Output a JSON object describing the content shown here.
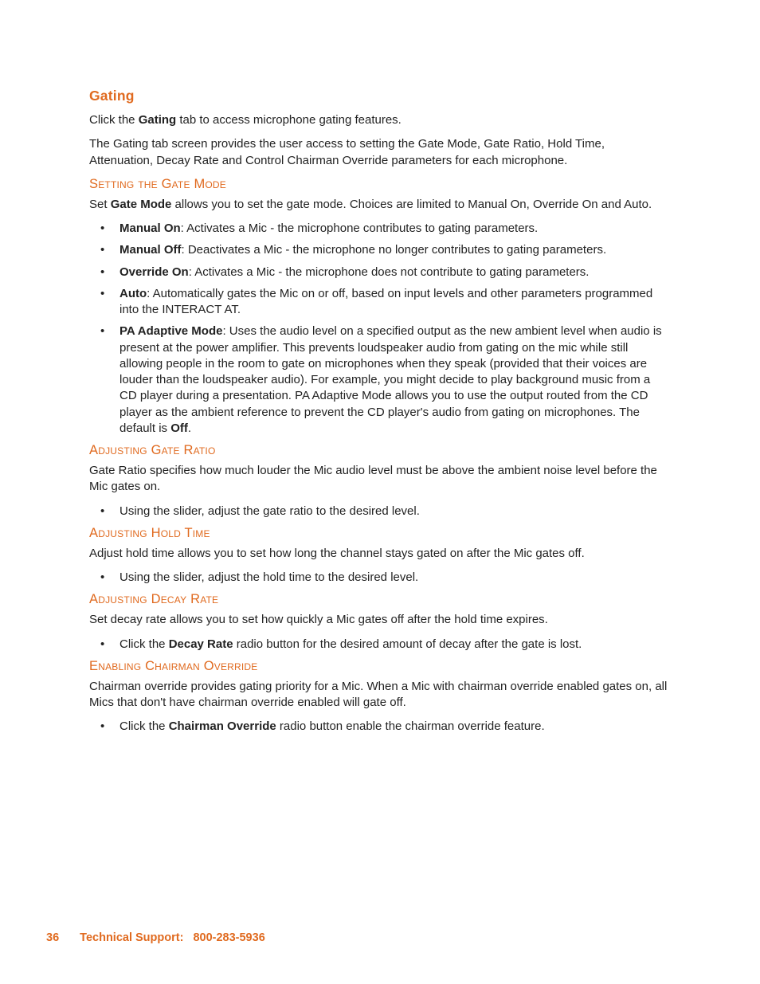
{
  "title": "Gating",
  "intro": {
    "click_the": "Click the ",
    "gating_bold": "Gating",
    "click_rest": " tab to access microphone gating features.",
    "desc": "The Gating tab screen provides the user access to setting the Gate Mode, Gate Ratio, Hold Time, Attenuation, Decay Rate and Control Chairman Override parameters for each microphone."
  },
  "setting_gate_mode": {
    "heading": "Setting the Gate Mode",
    "para_set": "Set ",
    "para_bold": "Gate Mode",
    "para_rest": " allows you to set the gate mode. Choices are limited to Manual On, Override On and Auto.",
    "items": [
      {
        "label": "Manual On",
        "text": ": Activates a Mic - the microphone contributes to gating parameters."
      },
      {
        "label": "Manual Off",
        "text": ": Deactivates a Mic - the microphone no longer contributes to gating parameters."
      },
      {
        "label": "Override On",
        "text": ": Activates a Mic - the microphone does not contribute to gating parameters."
      },
      {
        "label": "Auto",
        "text": ": Automatically gates the Mic on or off, based on input levels and other parameters programmed into the INTERACT AT."
      },
      {
        "label": "PA Adaptive Mode",
        "text": ": Uses the audio level on a specified output as the new ambient level when audio is present at the power amplifier. This prevents loudspeaker audio from gating on the mic while still allowing people in the room to gate on microphones when they speak (provided that their voices are louder than the loudspeaker audio). For example, you might decide to play background music from a CD player during a presentation. PA Adaptive Mode allows you to use the output routed from the CD player as the ambient reference to prevent the CD player's audio from gating on microphones. The default is ",
        "tail_bold": "Off",
        "tail_after": "."
      }
    ]
  },
  "gate_ratio": {
    "heading": "Adjusting Gate Ratio",
    "para": "Gate Ratio specifies how much louder the Mic audio level must be above the ambient noise level before the Mic gates on.",
    "item": "Using the slider, adjust the gate ratio to the desired level."
  },
  "hold_time": {
    "heading": "Adjusting Hold Time",
    "para": "Adjust hold time allows you to set how long the channel stays gated on after the Mic gates off.",
    "item": "Using the slider, adjust the hold time to the desired level."
  },
  "decay_rate": {
    "heading": "Adjusting Decay Rate",
    "para": "Set decay rate allows you to set how quickly a Mic gates off after the hold time expires.",
    "item_pre": "Click the ",
    "item_bold": "Decay Rate",
    "item_post": " radio button for the desired amount of decay after the gate is lost."
  },
  "chairman": {
    "heading": "Enabling Chairman Override",
    "para": "Chairman override provides gating priority for a Mic. When a Mic with chairman override enabled gates on, all Mics that don't have chairman override enabled will gate off.",
    "item_pre": "Click the ",
    "item_bold": "Chairman Override",
    "item_post": " radio button enable the chairman override feature."
  },
  "footer": {
    "page": "36",
    "label": "Technical Support:",
    "phone": "800-283-5936"
  }
}
